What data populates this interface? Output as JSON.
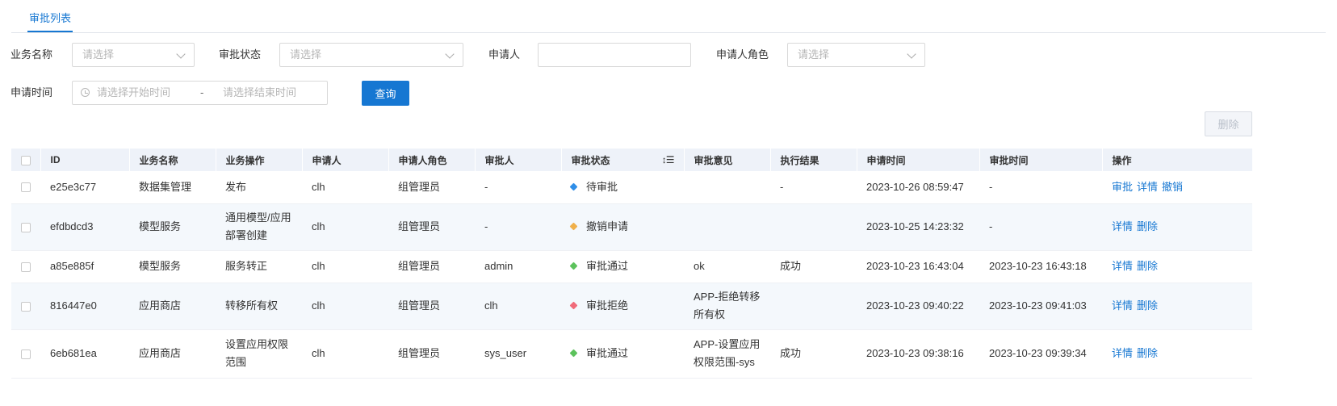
{
  "tabs": {
    "active": "审批列表"
  },
  "filters": {
    "business_name": {
      "label": "业务名称",
      "placeholder": "请选择"
    },
    "status": {
      "label": "审批状态",
      "placeholder": "请选择"
    },
    "applicant": {
      "label": "申请人",
      "value": ""
    },
    "applicant_role": {
      "label": "申请人角色",
      "placeholder": "请选择"
    },
    "time": {
      "label": "申请时间",
      "start_placeholder": "请选择开始时间",
      "separator": "-",
      "end_placeholder": "请选择结束时间"
    },
    "query_button": "查询"
  },
  "delete_button": "删除",
  "table": {
    "columns": [
      "ID",
      "业务名称",
      "业务操作",
      "申请人",
      "申请人角色",
      "审批人",
      "审批状态",
      "审批意见",
      "执行结果",
      "申请时间",
      "审批时间",
      "操作"
    ],
    "rows": [
      {
        "id": "e25e3c77",
        "business": "数据集管理",
        "operation": "发布",
        "applicant": "clh",
        "role": "组管理员",
        "approver": "-",
        "status": "待审批",
        "status_color": "#2f8ee8",
        "opinion": "",
        "result": "-",
        "apply_time": "2023-10-26 08:59:47",
        "approve_time": "-",
        "actions": [
          "审批",
          "详情",
          "撤销"
        ]
      },
      {
        "id": "efdbdcd3",
        "business": "模型服务",
        "operation": "通用模型/应用部署创建",
        "applicant": "clh",
        "role": "组管理员",
        "approver": "-",
        "status": "撤销申请",
        "status_color": "#f0b04a",
        "opinion": "",
        "result": "",
        "apply_time": "2023-10-25 14:23:32",
        "approve_time": "-",
        "actions": [
          "详情",
          "删除"
        ]
      },
      {
        "id": "a85e885f",
        "business": "模型服务",
        "operation": "服务转正",
        "applicant": "clh",
        "role": "组管理员",
        "approver": "admin",
        "status": "审批通过",
        "status_color": "#5cc25c",
        "opinion": "ok",
        "result": "成功",
        "apply_time": "2023-10-23 16:43:04",
        "approve_time": "2023-10-23 16:43:18",
        "actions": [
          "详情",
          "删除"
        ]
      },
      {
        "id": "816447e0",
        "business": "应用商店",
        "operation": "转移所有权",
        "applicant": "clh",
        "role": "组管理员",
        "approver": "clh",
        "status": "审批拒绝",
        "status_color": "#f06b7a",
        "opinion": "APP-拒绝转移所有权",
        "result": "",
        "apply_time": "2023-10-23 09:40:22",
        "approve_time": "2023-10-23 09:41:03",
        "actions": [
          "详情",
          "删除"
        ]
      },
      {
        "id": "6eb681ea",
        "business": "应用商店",
        "operation": "设置应用权限范围",
        "applicant": "clh",
        "role": "组管理员",
        "approver": "sys_user",
        "status": "审批通过",
        "status_color": "#5cc25c",
        "opinion": "APP-设置应用权限范围-sys",
        "result": "成功",
        "apply_time": "2023-10-23 09:38:16",
        "approve_time": "2023-10-23 09:39:34",
        "actions": [
          "详情",
          "删除"
        ]
      }
    ]
  }
}
